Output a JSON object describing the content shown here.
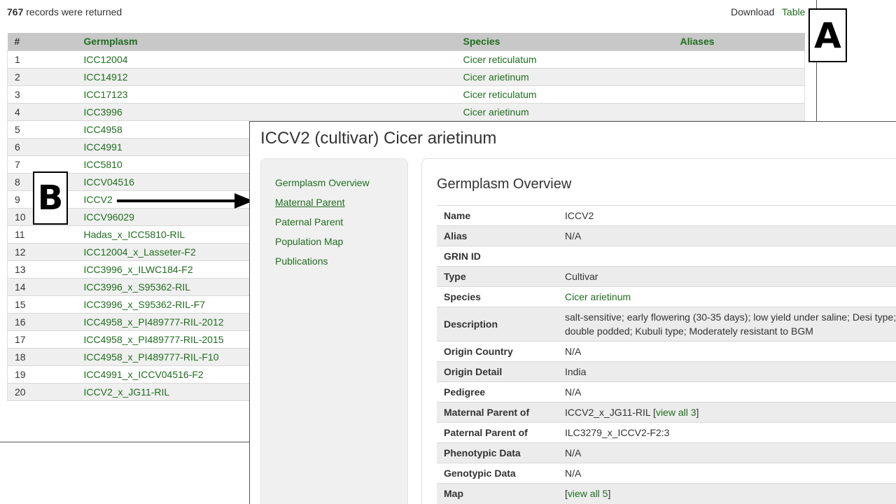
{
  "header": {
    "record_count": "767",
    "record_suffix": "records were returned",
    "download_label": "Download",
    "table_label": "Table"
  },
  "results_table": {
    "columns": [
      "#",
      "Germplasm",
      "Species",
      "Aliases"
    ],
    "rows": [
      {
        "num": "1",
        "germplasm": "ICC12004",
        "species": "Cicer reticulatum",
        "aliases": ""
      },
      {
        "num": "2",
        "germplasm": "ICC14912",
        "species": "Cicer arietinum",
        "aliases": ""
      },
      {
        "num": "3",
        "germplasm": "ICC17123",
        "species": "Cicer reticulatum",
        "aliases": ""
      },
      {
        "num": "4",
        "germplasm": "ICC3996",
        "species": "Cicer arietinum",
        "aliases": ""
      },
      {
        "num": "5",
        "germplasm": "ICC4958",
        "species": "",
        "aliases": ""
      },
      {
        "num": "6",
        "germplasm": "ICC4991",
        "species": "",
        "aliases": ""
      },
      {
        "num": "7",
        "germplasm": "ICC5810",
        "species": "",
        "aliases": ""
      },
      {
        "num": "8",
        "germplasm": "ICCV04516",
        "species": "",
        "aliases": ""
      },
      {
        "num": "9",
        "germplasm": "ICCV2",
        "species": "",
        "aliases": ""
      },
      {
        "num": "10",
        "germplasm": "ICCV96029",
        "species": "",
        "aliases": ""
      },
      {
        "num": "11",
        "germplasm": "Hadas_x_ICC5810-RIL",
        "species": "",
        "aliases": ""
      },
      {
        "num": "12",
        "germplasm": "ICC12004_x_Lasseter-F2",
        "species": "",
        "aliases": ""
      },
      {
        "num": "13",
        "germplasm": "ICC3996_x_ILWC184-F2",
        "species": "",
        "aliases": ""
      },
      {
        "num": "14",
        "germplasm": "ICC3996_x_S95362-RIL",
        "species": "",
        "aliases": ""
      },
      {
        "num": "15",
        "germplasm": "ICC3996_x_S95362-RIL-F7",
        "species": "",
        "aliases": ""
      },
      {
        "num": "16",
        "germplasm": "ICC4958_x_PI489777-RIL-2012",
        "species": "",
        "aliases": ""
      },
      {
        "num": "17",
        "germplasm": "ICC4958_x_PI489777-RIL-2015",
        "species": "",
        "aliases": ""
      },
      {
        "num": "18",
        "germplasm": "ICC4958_x_PI489777-RIL-F10",
        "species": "",
        "aliases": ""
      },
      {
        "num": "19",
        "germplasm": "ICC4991_x_ICCV04516-F2",
        "species": "",
        "aliases": ""
      },
      {
        "num": "20",
        "germplasm": "ICCV2_x_JG11-RIL",
        "species": "",
        "aliases": ""
      }
    ]
  },
  "callouts": {
    "a": "A",
    "b": "B"
  },
  "detail": {
    "title": "ICCV2 (cultivar) Cicer arietinum",
    "nav": [
      {
        "label": "Germplasm Overview",
        "active": false
      },
      {
        "label": "Maternal Parent",
        "active": true
      },
      {
        "label": "Paternal Parent",
        "active": false
      },
      {
        "label": "Population Map",
        "active": false
      },
      {
        "label": "Publications",
        "active": false
      }
    ],
    "section_title": "Germplasm Overview",
    "fields": [
      {
        "key": "Name",
        "value": "ICCV2"
      },
      {
        "key": "Alias",
        "value": "N/A"
      },
      {
        "key": "GRIN ID",
        "value": ""
      },
      {
        "key": "Type",
        "value": "Cultivar"
      },
      {
        "key": "Species",
        "value": "Cicer arietinum"
      },
      {
        "key": "Description",
        "value": "salt-sensitive; early flowering (30-35 days); low yield under saline; Desi type; double podded; Kubuli type; Moderately resistant to BGM"
      },
      {
        "key": "Origin Country",
        "value": "N/A"
      },
      {
        "key": "Origin Detail",
        "value": "India"
      },
      {
        "key": "Pedigree",
        "value": "N/A"
      },
      {
        "key": "Maternal Parent of",
        "value": "ICCV2_x_JG11-RIL [",
        "link": "view all 3",
        "suffix": "]"
      },
      {
        "key": "Paternal Parent of",
        "value": "ILC3279_x_ICCV2-F2:3"
      },
      {
        "key": "Phenotypic Data",
        "value": "N/A"
      },
      {
        "key": "Genotypic Data",
        "value": "N/A"
      },
      {
        "key": "Map",
        "value": "[",
        "link": "view all 5",
        "suffix": "]"
      }
    ]
  },
  "colors": {
    "link_green": "#1f6d1f",
    "header_gray": "#c8c8c8",
    "stripe": "#efefef"
  }
}
